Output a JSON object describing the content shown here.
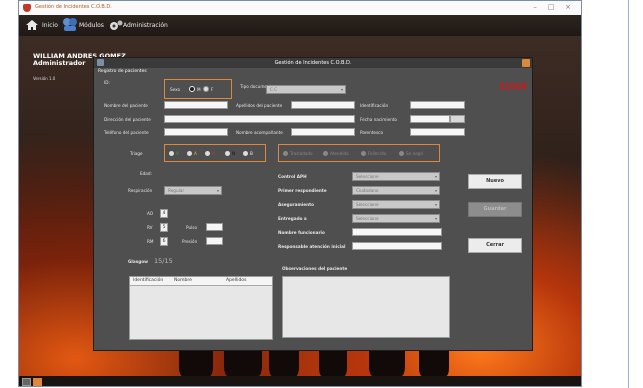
{
  "window": {
    "title": "Gestión de Incidentes C.O.B.D."
  },
  "menu": {
    "inicio": "Inicio",
    "modulos": "Módulos",
    "administracion": "Administración"
  },
  "user": {
    "name": "WILLIAM ANDRES GOMEZ",
    "role": "Administrador",
    "version": "Versión 1.0"
  },
  "dialog": {
    "title": "Gestión de Incidentes C.O.B.D.",
    "subtitle": "Registro de pacientes",
    "id_label": "ID:",
    "sexo_label": "Sexo",
    "sexo_m": "M",
    "sexo_f": "F",
    "tipo_doc_label": "Tipo documento",
    "tipo_doc_value": "C.C",
    "record_number": "21029",
    "nombre_label": "Nombre del paciente",
    "apellidos_label": "Apellidos del paciente",
    "identificacion_label": "Identificación",
    "direccion_label": "Dirección del paciente",
    "fecha_label": "Fecha nacimiento",
    "telefono_label": "Teléfono del paciente",
    "acompanante_label": "Nombre acompañante",
    "parentesco_label": "Parentesco",
    "triage_label": "Triage",
    "triage_options": [
      "V",
      "A",
      "R",
      "N",
      "B"
    ],
    "traslado_options": [
      "Trasladado",
      "Atendido",
      "Fallecido",
      "Se negó"
    ],
    "edad_label": "Edad:",
    "respiracion_label": "Respiración",
    "respiracion_value": "Regular",
    "control_label": "Control APH",
    "control_value": "Seleccione",
    "primer_label": "Primer respondiente",
    "primer_value": "Ciudadano",
    "aseguramiento_label": "Aseguramiento",
    "aseguramiento_value": "Seleccione",
    "entregado_label": "Entregado a",
    "entregado_value": "Seleccione",
    "funcionario_label": "Nombre funcionario",
    "responsable_label": "Responsable atención inicial",
    "ao_label": "AO",
    "ao_value": "4",
    "rv_label": "RV",
    "rv_value": "5",
    "rm_label": "RM",
    "rm_value": "6",
    "pulso_label": "Pulso",
    "presion_label": "Presión",
    "glasgow_label": "Glasgow",
    "glasgow_value": "15/15",
    "table_headers": [
      "Identificación",
      "Nombre",
      "Apellidos"
    ],
    "observaciones_label": "Observaciones del paciente",
    "nuevo_button": "Nuevo",
    "guardar_button": "Guardar",
    "cerrar_button": "Cerrar"
  },
  "colors": {
    "accent": "#e0883a",
    "record": "#e01010"
  }
}
